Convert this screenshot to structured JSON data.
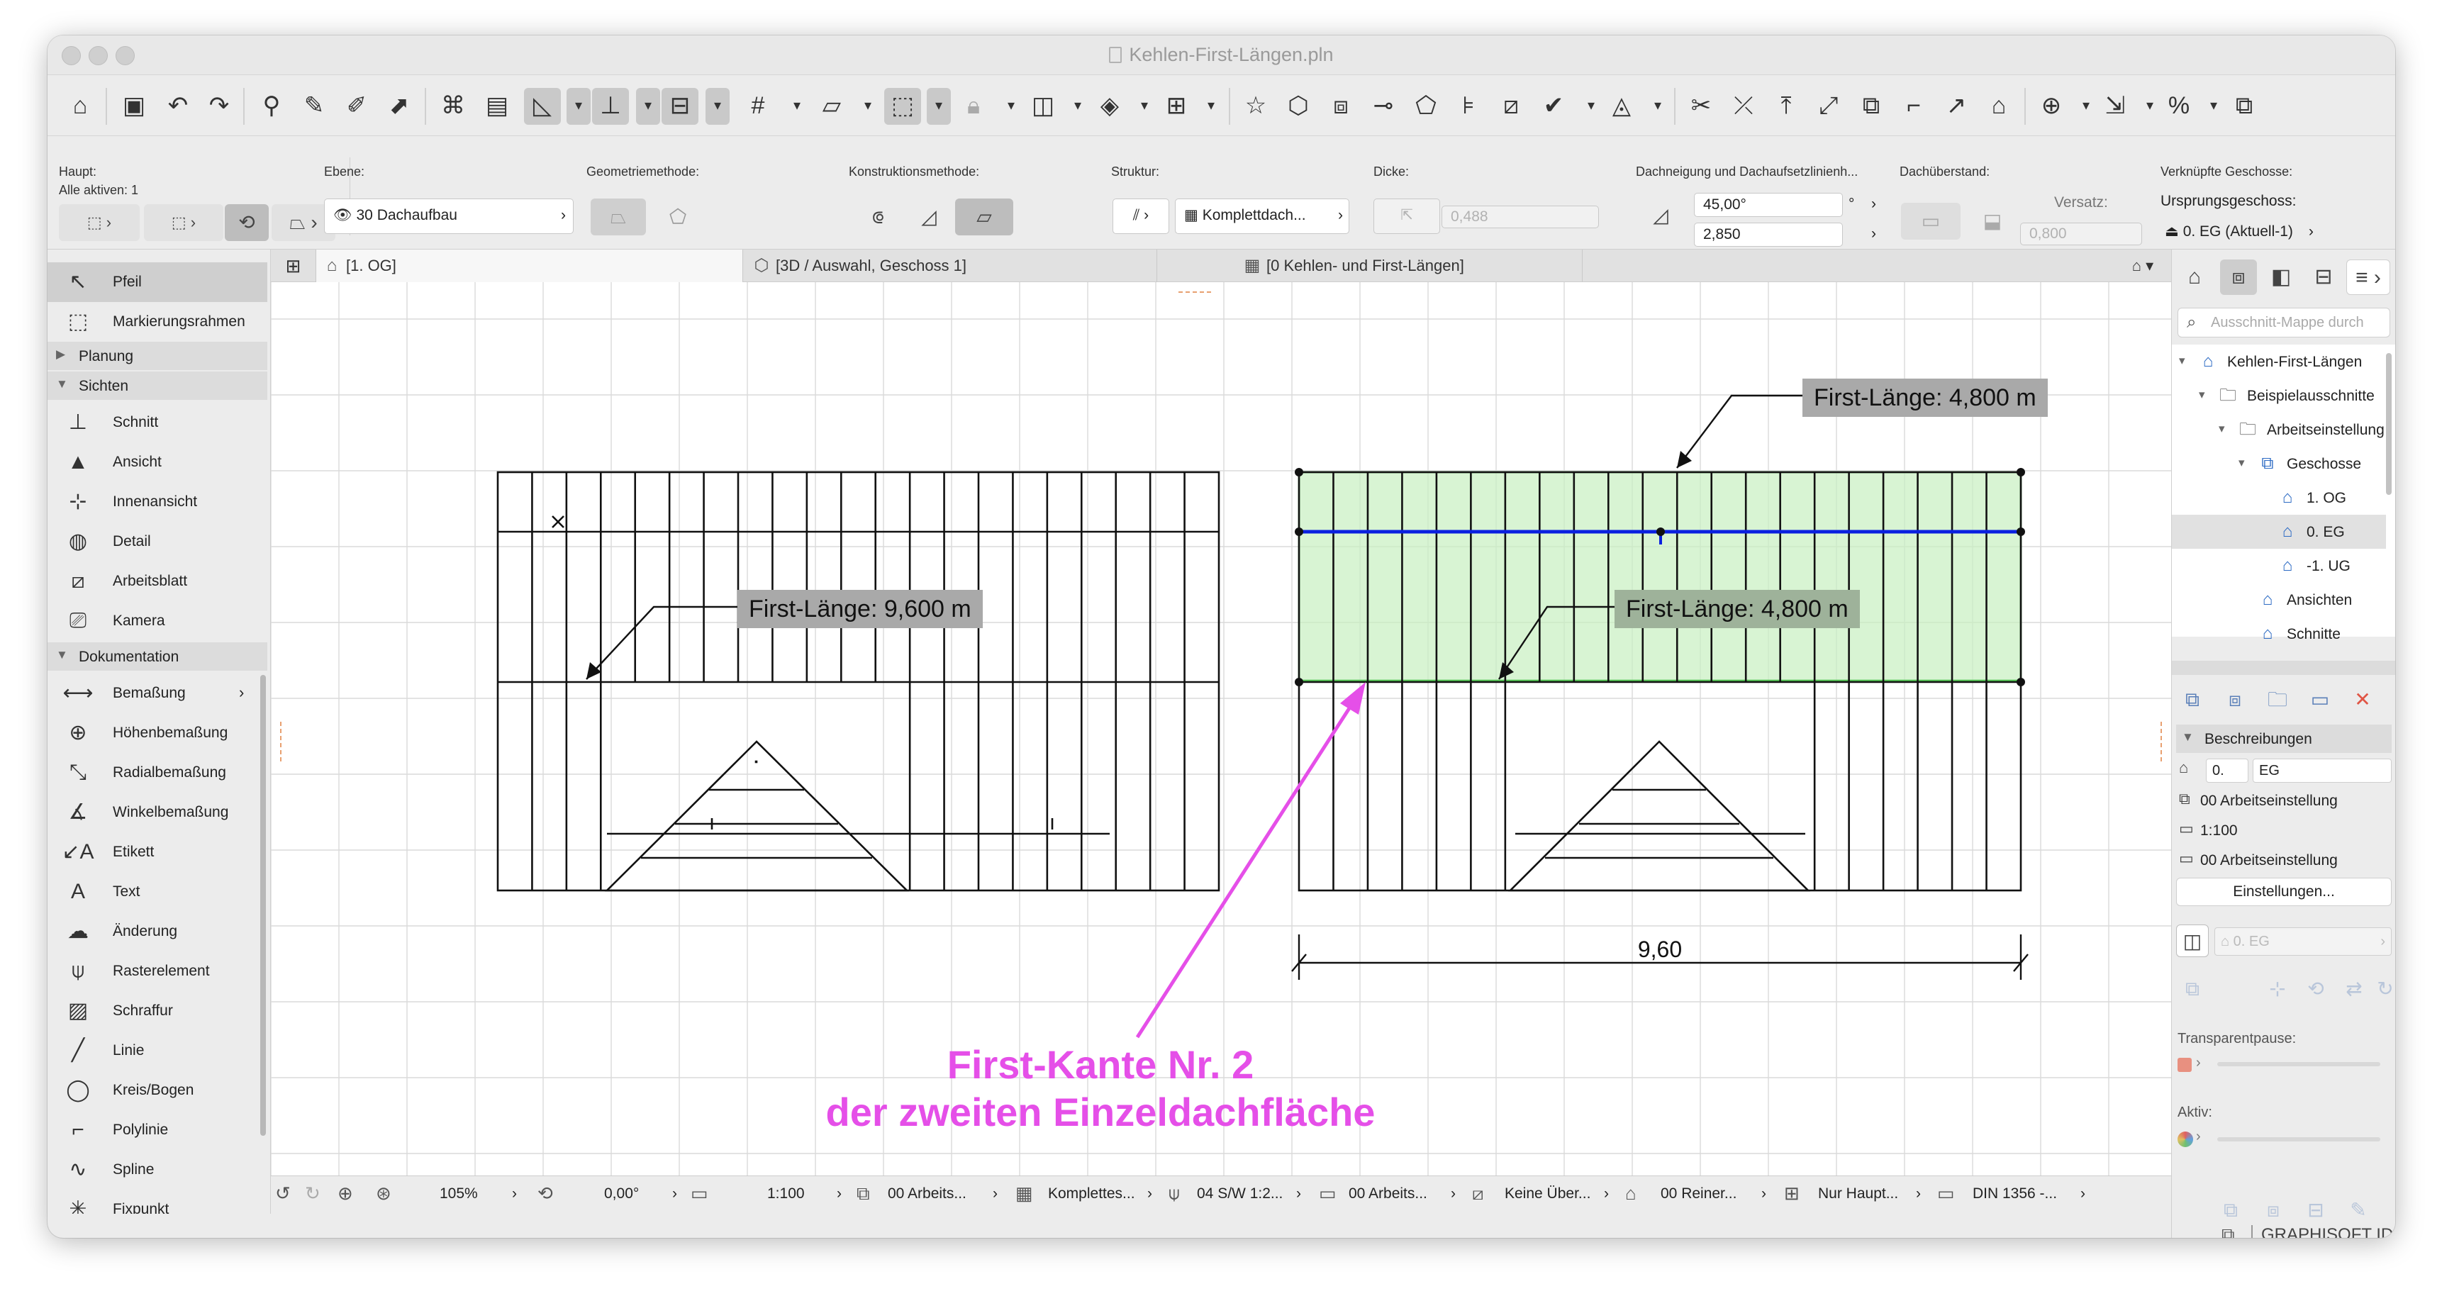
{
  "window": {
    "title": "Kehlen-First-Längen.pln"
  },
  "toolbar": {
    "icons": [
      "home-icon",
      "save-icon",
      "undo-icon",
      "redo-icon",
      "pick-up-parameters-icon",
      "inject-parameters-icon",
      "pencil-icon",
      "magic-wand-icon",
      "suspend-groups-icon",
      "renovation-filter-icon",
      "guide-lines-icon",
      "snap-guides-icon",
      "gravity-icon",
      "grid-snap-icon",
      "trace-icon",
      "marquee-icon",
      "lock-icon",
      "layer-icon",
      "view-icon",
      "element-info-icon",
      "favorites-icon",
      "3d-cut-icon",
      "3d-window-icon",
      "wall-end-icon",
      "attribute-icon",
      "label-tool-icon",
      "measure-icon",
      "check-icon",
      "solid-ops-icon",
      "split-icon",
      "adjust-icon",
      "stretch-icon",
      "resize-icon",
      "offset-icon",
      "fillet-icon",
      "roof-icon",
      "add-icon",
      "drag-icon",
      "rotate-icon",
      "percent-icon",
      "copy-icon"
    ]
  },
  "infobox": {
    "haupt_label": "Haupt:",
    "alle_aktiven": "Alle aktiven: 1",
    "ebene_label": "Ebene:",
    "ebene_value": "30 Dachaufbau",
    "geometrie_label": "Geometriemethode:",
    "konstruktion_label": "Konstruktionsmethode:",
    "struktur_label": "Struktur:",
    "struktur_value": "Komplettdach...",
    "dicke_label": "Dicke:",
    "dicke_value": "0,488",
    "neigung_label": "Dachneigung und Dachaufsetzlinienh...",
    "neigung_value": "45,00°",
    "neigung_unit": "°",
    "hoehe_value": "2,850",
    "ueberstand_label": "Dachüberstand:",
    "versatz_label": "Versatz:",
    "versatz_value": "0,800",
    "geschosse_label": "Verknüpfte Geschosse:",
    "ursprung_label": "Ursprungsgeschoss:",
    "ursprung_value": "0. EG (Aktuell-1)"
  },
  "leftpanel": {
    "top_items": [
      {
        "label": "Pfeil",
        "icon": "arrow-icon"
      },
      {
        "label": "Markierungsrahmen",
        "icon": "marquee-icon"
      }
    ],
    "sec_planung": "Planung",
    "sec_sichten": "Sichten",
    "sichten": [
      {
        "label": "Schnitt",
        "icon": "section-icon"
      },
      {
        "label": "Ansicht",
        "icon": "elevation-icon"
      },
      {
        "label": "Innenansicht",
        "icon": "interior-elevation-icon"
      },
      {
        "label": "Detail",
        "icon": "detail-icon"
      },
      {
        "label": "Arbeitsblatt",
        "icon": "worksheet-icon"
      },
      {
        "label": "Kamera",
        "icon": "camera-icon"
      }
    ],
    "sec_dokumentation": "Dokumentation",
    "doku": [
      {
        "label": "Bemaßung",
        "icon": "dimension-icon"
      },
      {
        "label": "Höhenbemaßung",
        "icon": "level-dimension-icon"
      },
      {
        "label": "Radialbemaßung",
        "icon": "radial-dimension-icon"
      },
      {
        "label": "Winkelbemaßung",
        "icon": "angle-dimension-icon"
      },
      {
        "label": "Etikett",
        "icon": "label-icon"
      },
      {
        "label": "Text",
        "icon": "text-icon"
      },
      {
        "label": "Änderung",
        "icon": "change-icon"
      },
      {
        "label": "Rasterelement",
        "icon": "grid-element-icon"
      },
      {
        "label": "Schraffur",
        "icon": "fill-icon"
      },
      {
        "label": "Linie",
        "icon": "line-icon"
      },
      {
        "label": "Kreis/Bogen",
        "icon": "arc-icon"
      },
      {
        "label": "Polylinie",
        "icon": "polyline-icon"
      },
      {
        "label": "Spline",
        "icon": "spline-icon"
      },
      {
        "label": "Fixpunkt",
        "icon": "hotspot-icon"
      }
    ]
  },
  "tabs": [
    {
      "label": "[1. OG]",
      "icon": "floor-plan-icon"
    },
    {
      "label": "[3D / Auswahl, Geschoss 1]",
      "icon": "3d-icon"
    },
    {
      "label": "[0 Kehlen- und First-Längen]",
      "icon": "worksheet-icon"
    }
  ],
  "canvas": {
    "callout_left": "First-Länge: 9,600 m",
    "callout_right_top": "First-Länge: 4,800 m",
    "callout_right_mid": "First-Länge: 4,800 m",
    "dimension": "9,60",
    "annotation_line1": "First-Kante Nr. 2",
    "annotation_line2": "der zweiten Einzeldachfläche",
    "colors": {
      "selection": "#c8f0c0",
      "selection_border": "#55c455",
      "ridge": "#0a20e0",
      "annotation": "#e54fe8",
      "callout_bg": "#a9a9a9"
    }
  },
  "statusbar": {
    "zoom": "105%",
    "angle": "0,00°",
    "scale": "1:100",
    "layer_combo": "00 Arbeits...",
    "model_view": "Komplettes...",
    "pen_set": "04 S/W 1:2...",
    "view_option": "00 Arbeits...",
    "override": "Keine Über...",
    "renovation": "00 Reiner...",
    "structure": "Nur Haupt...",
    "dim_standard": "DIN 1356 -..."
  },
  "rightpanel": {
    "search_placeholder": "Ausschnitt-Mappe durch",
    "tree": [
      {
        "label": "Kehlen-First-Längen",
        "icon": "project-icon",
        "level": 0,
        "chev": "▾"
      },
      {
        "label": "Beispielausschnitte",
        "icon": "folder-icon",
        "level": 1,
        "chev": "▾"
      },
      {
        "label": "Arbeitseinstellung",
        "icon": "folder-icon",
        "level": 2,
        "chev": "▾"
      },
      {
        "label": "Geschosse",
        "icon": "stories-icon",
        "level": 3,
        "chev": "▾"
      },
      {
        "label": "1. OG",
        "icon": "floor-icon",
        "level": 4,
        "chev": ""
      },
      {
        "label": "0. EG",
        "icon": "floor-icon",
        "level": 4,
        "chev": ""
      },
      {
        "label": "-1. UG",
        "icon": "floor-icon",
        "level": 4,
        "chev": ""
      },
      {
        "label": "Ansichten",
        "icon": "elevation-icon",
        "level": 3,
        "chev": ""
      },
      {
        "label": "Schnitte",
        "icon": "section-icon",
        "level": 3,
        "chev": ""
      }
    ],
    "beschreibungen": "Beschreibungen",
    "id_value": "0.",
    "name_value": "EG",
    "layer_set": "00 Arbeitseinstellung",
    "scale": "1:100",
    "view_opt": "00 Arbeitseinstellung",
    "einstellungen": "Einstellungen...",
    "story_field": "0. EG",
    "transparent": "Transparentpause:",
    "aktiv": "Aktiv:",
    "graphisoft_id": "GRAPHISOFT ID"
  }
}
